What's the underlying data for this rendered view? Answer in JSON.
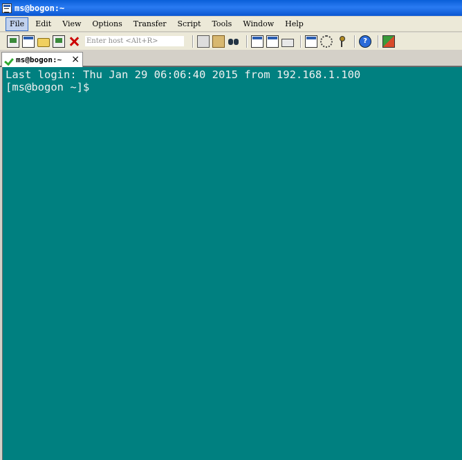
{
  "window": {
    "title": "ms@bogon:~"
  },
  "menu": {
    "items": [
      {
        "label": "File"
      },
      {
        "label": "Edit"
      },
      {
        "label": "View"
      },
      {
        "label": "Options"
      },
      {
        "label": "Transfer"
      },
      {
        "label": "Script"
      },
      {
        "label": "Tools"
      },
      {
        "label": "Window"
      },
      {
        "label": "Help"
      }
    ],
    "active": "File"
  },
  "toolbar": {
    "host_placeholder": "Enter host <Alt+R>",
    "icons": [
      "connect-icon",
      "quick-connect-icon",
      "connect-in-tab-icon",
      "reconnect-icon",
      "disconnect-icon",
      "copy-icon",
      "paste-icon",
      "find-icon",
      "print-setup-icon",
      "print-icon",
      "print-selection-icon",
      "session-options-icon",
      "global-options-icon",
      "keymap-icon",
      "help-icon",
      "sftp-icon"
    ]
  },
  "tab": {
    "label": "ms@bogon:~",
    "close": "×"
  },
  "terminal": {
    "lines": [
      "Last login: Thu Jan 29 06:06:40 2015 from 192.168.1.100",
      "[ms@bogon ~]$"
    ],
    "background": "#008080",
    "foreground": "#f0f0f0"
  }
}
